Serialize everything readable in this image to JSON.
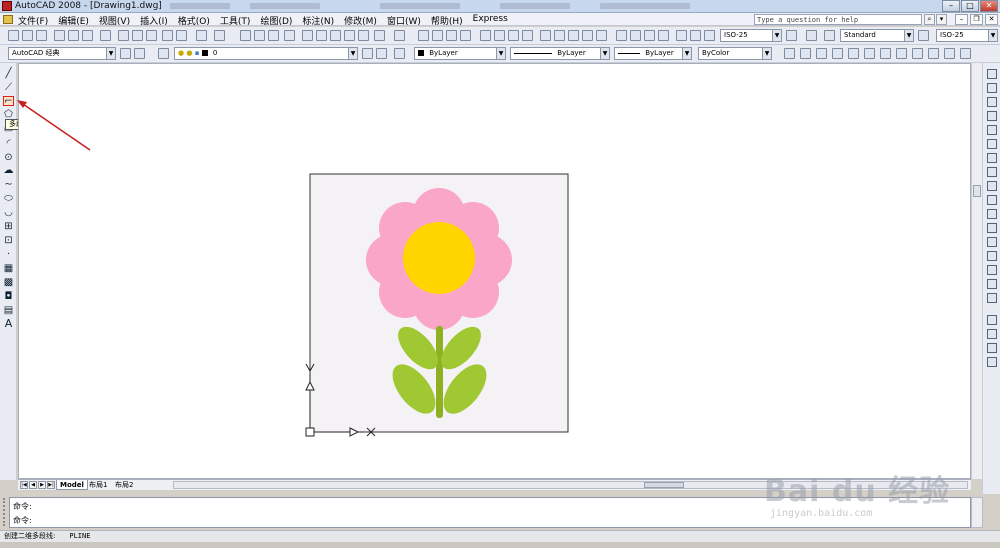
{
  "app": {
    "title": "AutoCAD 2008 - [Drawing1.dwg]",
    "help_placeholder": "Type a question for help"
  },
  "menu": {
    "items": [
      "文件(F)",
      "编辑(E)",
      "视图(V)",
      "插入(I)",
      "格式(O)",
      "工具(T)",
      "绘图(D)",
      "标注(N)",
      "修改(M)",
      "窗口(W)",
      "帮助(H)",
      "Express"
    ]
  },
  "toolbar": {
    "workspace": "AutoCAD 经典",
    "layer_value": "0",
    "color_value": "ByLayer",
    "linetype_value": "ByLayer",
    "lineweight_value": "ByLayer",
    "plotstyle_value": "ByColor",
    "dimstyle_value": "ISO-25",
    "textstyle_value": "Standard",
    "dimstyle_value2": "ISO-25"
  },
  "tooltip": {
    "text": "多段线"
  },
  "tabs": {
    "model": "Model",
    "layout1": "布局1",
    "layout2": "布局2"
  },
  "command": {
    "line1": "命令:",
    "line2": "命令:"
  },
  "status": {
    "text": "创建二维多段线:",
    "command_name": "PLINE"
  },
  "watermark": {
    "brand": "Bai du 经验",
    "url": "jingyan.baidu.com"
  },
  "drawing": {
    "petal_color": "#f9a6c8",
    "center_color": "#ffd500",
    "stem_color": "#8fb020",
    "leaf_color": "#9fc832",
    "frame_bg": "#f4f2f4"
  }
}
